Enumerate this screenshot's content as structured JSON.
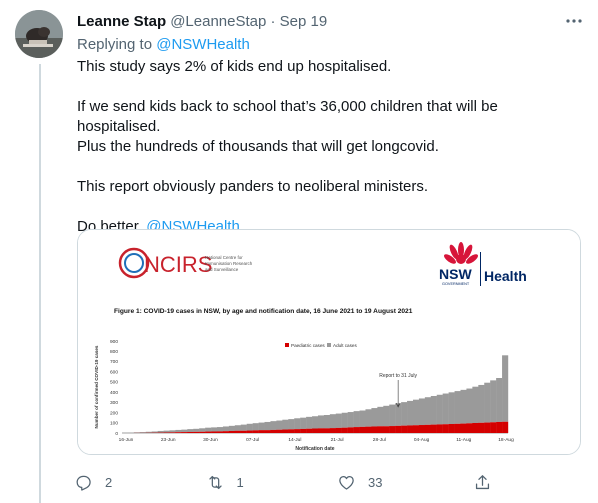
{
  "tweet": {
    "display_name": "Leanne Stap",
    "handle_and_time": "@LeanneStap · Sep 19",
    "replying_prefix": "Replying to ",
    "replying_to": "@NSWHealth",
    "paragraphs": [
      "This study says 2% of kids end up hospitalised.",
      "If we send kids back to school that’s 36,000 children that will be hospitalised.",
      "Plus the hundreds of thousands that will get longcovid.",
      "This report obviously panders to neoliberal ministers."
    ],
    "closing_prefix": "Do better, ",
    "closing_mention": "@NSWHealth",
    "closing_suffix": "."
  },
  "actions": {
    "reply_count": "2",
    "retweet_count": "1",
    "like_count": "33",
    "share_count": ""
  },
  "media": {
    "ncirs_logo": "NCIRS",
    "ncirs_subtitle_lines": [
      "National Centre for",
      "Immunisation Research",
      "and Surveillance"
    ],
    "nsw_logo": "NSW",
    "nsw_gov": "GOVERNMENT",
    "nsw_health": "Health"
  },
  "chart_data": {
    "type": "bar",
    "title": "Figure 1: COVID-19 cases in NSW, by age and notification date, 16 June 2021 to 19 August 2021",
    "xlabel": "Notification date",
    "ylabel": "Number of confirmed COVID-19 cases",
    "ylim": [
      0,
      900
    ],
    "yticks": [
      0,
      100,
      200,
      300,
      400,
      500,
      600,
      700,
      800,
      900
    ],
    "stacked": true,
    "legend_position": "top",
    "x_tick_labels": [
      "16-Jun",
      "23-Jun",
      "30-Jun",
      "07-Jul",
      "14-Jul",
      "21-Jul",
      "28-Jul",
      "04-Aug",
      "11-Aug",
      "18-Aug"
    ],
    "annotation": {
      "text": "Report to 31 July",
      "x_index": 46
    },
    "colors": {
      "paediatric": "#d40000",
      "adult": "#9a9a9a"
    },
    "categories_start": "16-Jun",
    "series": [
      {
        "name": "Paediatric cases",
        "values": [
          0,
          0,
          1,
          1,
          2,
          3,
          4,
          5,
          6,
          8,
          9,
          10,
          11,
          12,
          14,
          15,
          16,
          18,
          20,
          22,
          22,
          24,
          26,
          28,
          28,
          30,
          32,
          34,
          36,
          38,
          40,
          42,
          44,
          46,
          46,
          48,
          50,
          52,
          55,
          58,
          60,
          62,
          64,
          66,
          66,
          68,
          70,
          72,
          74,
          76,
          78,
          80,
          82,
          84,
          86,
          88,
          90,
          92,
          95,
          98,
          100,
          102,
          105,
          108,
          110
        ]
      },
      {
        "name": "Adult cases",
        "values": [
          2,
          4,
          6,
          8,
          10,
          12,
          16,
          18,
          20,
          22,
          24,
          28,
          30,
          34,
          38,
          40,
          42,
          46,
          50,
          54,
          60,
          66,
          70,
          74,
          80,
          86,
          90,
          96,
          100,
          106,
          110,
          116,
          120,
          126,
          130,
          136,
          140,
          146,
          150,
          156,
          160,
          170,
          180,
          190,
          200,
          210,
          220,
          230,
          240,
          250,
          260,
          270,
          280,
          290,
          300,
          310,
          320,
          330,
          340,
          355,
          370,
          390,
          410,
          430,
          650
        ]
      }
    ]
  }
}
